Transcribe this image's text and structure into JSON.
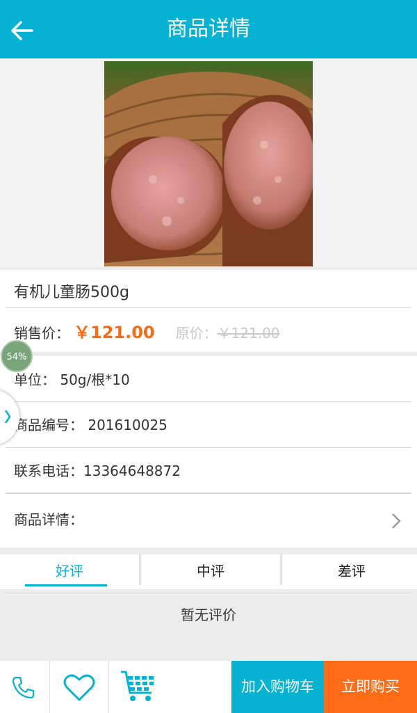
{
  "header": {
    "title": "商品详情"
  },
  "product": {
    "name": "有机儿童肠500g",
    "price_label": "销售价：",
    "price": "￥121.00",
    "original_label": "原价：",
    "original_price": "￥121.00"
  },
  "info": {
    "unit": "单位：  50g/根*10",
    "code": "商品编号：  201610025",
    "phone": "联系电话：13364648872",
    "details": "商品详情："
  },
  "tabs": [
    {
      "label": "好评",
      "active": true
    },
    {
      "label": "中评",
      "active": false
    },
    {
      "label": "差评",
      "active": false
    }
  ],
  "reviews": {
    "empty_text": "暂无评价"
  },
  "overlay": {
    "badge": "54%"
  },
  "bottom": {
    "icons": [
      "phone-icon",
      "heart-icon",
      "cart-icon"
    ],
    "add_to_cart": "加入购物车",
    "buy_now": "立即购买"
  },
  "colors": {
    "accent": "#05b2d2",
    "price": "#fb6a13",
    "buy": "#fe6c18"
  }
}
